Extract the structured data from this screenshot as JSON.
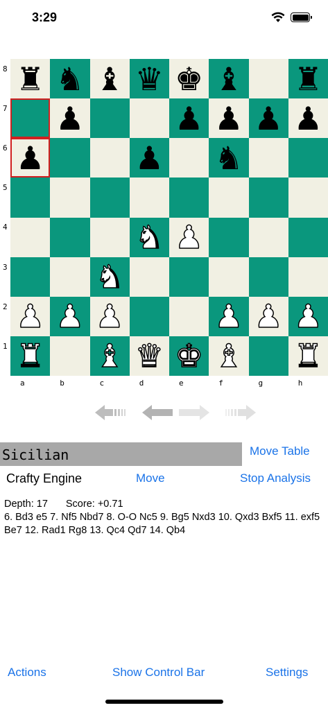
{
  "status": {
    "time": "3:29",
    "wifi_icon": "wifi-icon",
    "battery_icon": "battery-icon"
  },
  "board": {
    "light_color": "#f1f0e3",
    "dark_color": "#0a977d",
    "highlight_color": "#d12020",
    "rank_labels": [
      "8",
      "7",
      "6",
      "5",
      "4",
      "3",
      "2",
      "1"
    ],
    "file_labels": [
      "a",
      "b",
      "c",
      "d",
      "e",
      "f",
      "g",
      "h"
    ],
    "rows": [
      [
        "r",
        "n",
        "b",
        "q",
        "k",
        "b",
        "",
        "r"
      ],
      [
        "",
        "p",
        "",
        "",
        "p",
        "p",
        "p",
        "p"
      ],
      [
        "p",
        "",
        "",
        "p",
        "",
        "n",
        "",
        ""
      ],
      [
        "",
        "",
        "",
        "",
        "",
        "",
        "",
        ""
      ],
      [
        "",
        "",
        "",
        "N",
        "P",
        "",
        "",
        ""
      ],
      [
        "",
        "",
        "N",
        "",
        "",
        "",
        "",
        ""
      ],
      [
        "P",
        "P",
        "P",
        "",
        "",
        "P",
        "P",
        "P"
      ],
      [
        "R",
        "",
        "B",
        "Q",
        "K",
        "B",
        "",
        "R"
      ]
    ],
    "highlighted_squares": [
      "a7",
      "a6"
    ]
  },
  "navigation": {
    "first_icon": "skip-back-icon",
    "back_icon": "arrow-left-icon",
    "forward_icon": "arrow-right-icon",
    "last_icon": "skip-forward-icon"
  },
  "opening": {
    "name": "Sicilian"
  },
  "links": {
    "move_table": "Move Table",
    "move": "Move",
    "stop_analysis": "Stop Analysis",
    "actions": "Actions",
    "show_control_bar": "Show Control Bar",
    "settings": "Settings"
  },
  "engine": {
    "name": "Crafty Engine",
    "depth": "Depth: 17",
    "score": "Score: +0.71",
    "line": "6. Bd3 e5 7. Nf5 Nbd7 8. O-O Nc5 9. Bg5 Nxd3 10. Qxd3 Bxf5 11. exf5 Be7 12. Rad1 Rg8 13. Qc4 Qd7 14. Qb4"
  }
}
